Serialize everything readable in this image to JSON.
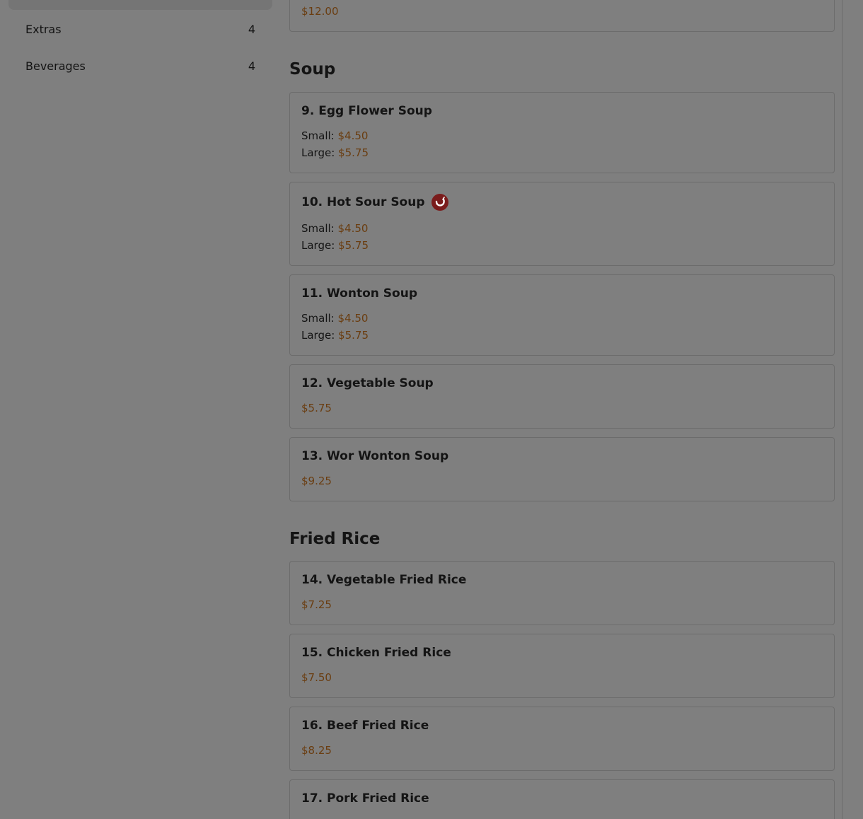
{
  "sidebar": {
    "categories": [
      {
        "label": "Extras",
        "count": "4"
      },
      {
        "label": "Beverages",
        "count": "4"
      }
    ]
  },
  "menu": {
    "previous_item_price": "$12.00",
    "sections": [
      {
        "title": "Soup",
        "items": [
          {
            "name": "9. Egg Flower Soup",
            "small_label": "Small:",
            "small_price": "$4.50",
            "large_label": "Large:",
            "large_price": "$5.75"
          },
          {
            "name": "10. Hot Sour Soup",
            "spicy": true,
            "small_label": "Small:",
            "small_price": "$4.50",
            "large_label": "Large:",
            "large_price": "$5.75"
          },
          {
            "name": "11. Wonton Soup",
            "small_label": "Small:",
            "small_price": "$4.50",
            "large_label": "Large:",
            "large_price": "$5.75"
          },
          {
            "name": "12. Vegetable Soup",
            "price": "$5.75"
          },
          {
            "name": "13. Wor Wonton Soup",
            "price": "$9.25"
          }
        ]
      },
      {
        "title": "Fried Rice",
        "items": [
          {
            "name": "14. Vegetable Fried Rice",
            "price": "$7.25"
          },
          {
            "name": "15. Chicken Fried Rice",
            "price": "$7.50"
          },
          {
            "name": "16. Beef Fried Rice",
            "price": "$8.25"
          },
          {
            "name": "17. Pork Fried Rice"
          }
        ]
      }
    ]
  },
  "colors": {
    "overlay_background": "#7f7f7f",
    "price": "#6a3d10",
    "spicy_icon": "#7a1c1c"
  },
  "icons": {
    "spicy": "chili-pepper-icon"
  }
}
